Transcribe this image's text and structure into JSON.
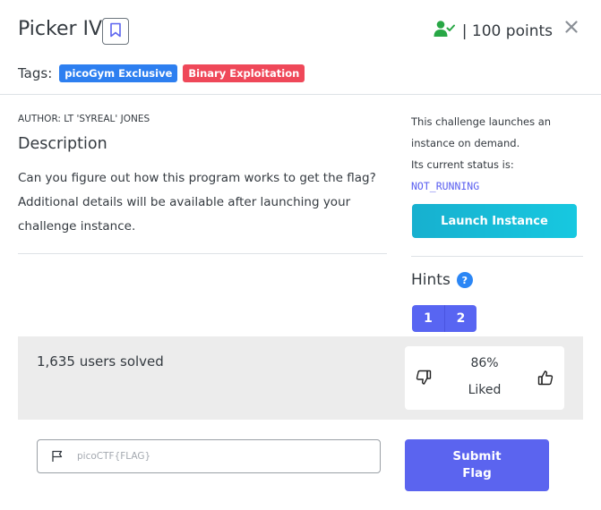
{
  "challenge": {
    "title": "Picker IV",
    "points_text": "| 100 points"
  },
  "tags": {
    "label": "Tags:",
    "items": [
      {
        "label": "picoGym Exclusive",
        "color": "#2d7ff0"
      },
      {
        "label": "Binary Exploitation",
        "color": "#ef4859"
      }
    ]
  },
  "description": {
    "author": "AUTHOR: LT 'SYREAL' JONES",
    "heading": "Description",
    "line1": "Can you figure out how this program works to get the flag?",
    "line2": "Additional details will be available after launching your",
    "line3": "challenge instance."
  },
  "instance": {
    "line1": "This challenge launches an",
    "line2": "instance on demand.",
    "line3": "Its current status is:",
    "status": "NOT_RUNNING",
    "launch_label": "Launch Instance"
  },
  "hints": {
    "label": "Hints",
    "help_glyph": "?",
    "items": [
      "1",
      "2"
    ]
  },
  "stats": {
    "solved": "1,635 users solved",
    "liked_pct": "86%",
    "liked_label": "Liked"
  },
  "flag": {
    "placeholder": "picoCTF{FLAG}",
    "submit_line1": "Submit",
    "submit_line2": "Flag"
  },
  "colors": {
    "accent": "#5b64ef",
    "teal": "#17c8e0",
    "success_icon": "#28a745",
    "band": "#ececec"
  },
  "icons": [
    "bookmark-icon",
    "user-check-icon",
    "close-icon",
    "question-icon",
    "thumbs-down-icon",
    "thumbs-up-icon",
    "flag-icon"
  ]
}
